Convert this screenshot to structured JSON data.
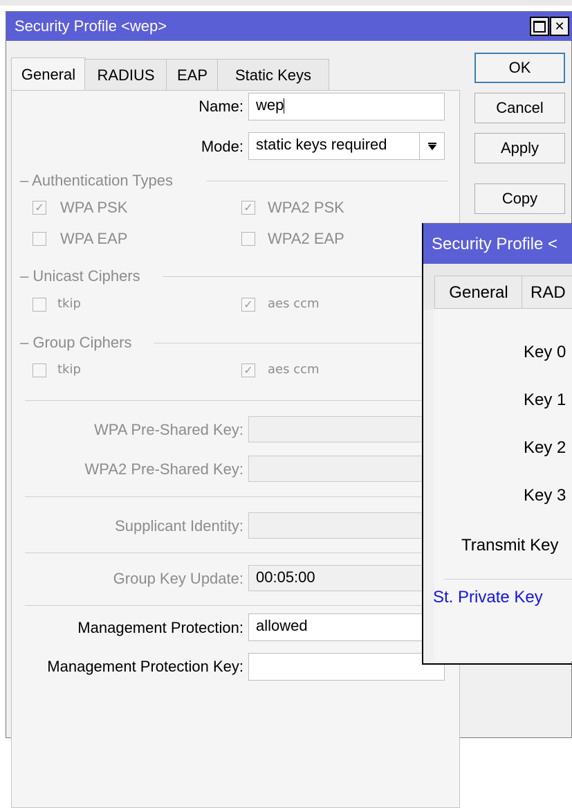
{
  "main": {
    "title": "Security Profile <wep>",
    "tabs": [
      "General",
      "RADIUS",
      "EAP",
      "Static Keys"
    ],
    "buttons": {
      "ok": "OK",
      "cancel": "Cancel",
      "apply": "Apply",
      "copy": "Copy"
    },
    "name": {
      "label": "Name:",
      "value": "wep"
    },
    "mode": {
      "label": "Mode:",
      "value": "static keys required"
    },
    "auth": {
      "title": "Authentication Types",
      "items": [
        {
          "label": "WPA PSK",
          "checked": true
        },
        {
          "label": "WPA2 PSK",
          "checked": true
        },
        {
          "label": "WPA EAP",
          "checked": false
        },
        {
          "label": "WPA2 EAP",
          "checked": false
        }
      ]
    },
    "unicast": {
      "title": "Unicast Ciphers",
      "items": [
        {
          "label": "tkip",
          "checked": false
        },
        {
          "label": "aes ccm",
          "checked": true
        }
      ]
    },
    "group": {
      "title": "Group Ciphers",
      "items": [
        {
          "label": "tkip",
          "checked": false
        },
        {
          "label": "aes ccm",
          "checked": true
        }
      ]
    },
    "wpa_psk_label": "WPA Pre-Shared Key:",
    "wpa2_psk_label": "WPA2 Pre-Shared Key:",
    "supplicant_label": "Supplicant Identity:",
    "group_key_update": {
      "label": "Group Key Update:",
      "value": "00:05:00"
    },
    "mgmt_protection": {
      "label": "Management Protection:",
      "value": "allowed"
    },
    "mgmt_key_label": "Management Protection Key:"
  },
  "overlay": {
    "title": "Security Profile <",
    "tabs": [
      "General",
      "RAD"
    ],
    "labels": [
      "Key 0",
      "Key 1",
      "Key 2",
      "Key 3",
      "Transmit Key"
    ],
    "private_key_label": "St. Private Key"
  }
}
